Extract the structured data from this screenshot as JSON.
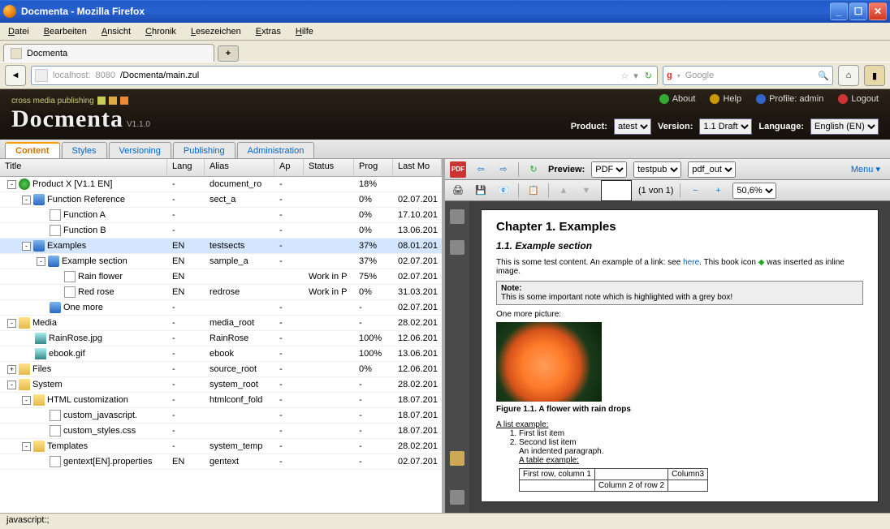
{
  "window": {
    "title": "Docmenta - Mozilla Firefox"
  },
  "ffmenu": [
    "Datei",
    "Bearbeiten",
    "Ansicht",
    "Chronik",
    "Lesezeichen",
    "Extras",
    "Hilfe"
  ],
  "tab": {
    "label": "Docmenta"
  },
  "url": {
    "host": "localhost:",
    "port": "8080",
    "path": "/Docmenta/main.zul"
  },
  "searchplaceholder": "Google",
  "brand": {
    "tagline": "cross media publishing",
    "name": "Docmenta",
    "version": "V1.1.0"
  },
  "headlinks": {
    "about": "About",
    "help": "Help",
    "profile": "Profile: admin",
    "logout": "Logout"
  },
  "selectors": {
    "product_label": "Product:",
    "product": "atest",
    "version_label": "Version:",
    "version": "1.1 Draft",
    "language_label": "Language:",
    "language": "English (EN)"
  },
  "tabs": [
    "Content",
    "Styles",
    "Versioning",
    "Publishing",
    "Administration"
  ],
  "active_tab": "Content",
  "columns": {
    "title": "Title",
    "lang": "Lang",
    "alias": "Alias",
    "ap": "Ap",
    "status": "Status",
    "prog": "Prog",
    "lm": "Last Mo"
  },
  "rows": [
    {
      "indent": 0,
      "toggle": "-",
      "icon": "product",
      "title": "Product X [V1.1 EN]",
      "lang": "-",
      "alias": "document_ro",
      "ap": "-",
      "status": "",
      "prog": "18%",
      "lm": ""
    },
    {
      "indent": 1,
      "toggle": "-",
      "icon": "book",
      "title": "Function Reference",
      "lang": "-",
      "alias": "sect_a",
      "ap": "-",
      "status": "",
      "prog": "0%",
      "lm": "02.07.201"
    },
    {
      "indent": 2,
      "toggle": "",
      "icon": "doc",
      "title": "Function A",
      "lang": "-",
      "alias": "",
      "ap": "-",
      "status": "",
      "prog": "0%",
      "lm": "17.10.201"
    },
    {
      "indent": 2,
      "toggle": "",
      "icon": "doc",
      "title": "Function B",
      "lang": "-",
      "alias": "",
      "ap": "-",
      "status": "",
      "prog": "0%",
      "lm": "13.06.201"
    },
    {
      "indent": 1,
      "toggle": "-",
      "icon": "book",
      "title": "Examples",
      "lang": "EN",
      "alias": "testsects",
      "ap": "-",
      "status": "",
      "prog": "37%",
      "lm": "08.01.201",
      "sel": true
    },
    {
      "indent": 2,
      "toggle": "-",
      "icon": "book",
      "title": "Example section",
      "lang": "EN",
      "alias": "sample_a",
      "ap": "-",
      "status": "",
      "prog": "37%",
      "lm": "02.07.201"
    },
    {
      "indent": 3,
      "toggle": "",
      "icon": "doc",
      "title": "Rain flower",
      "lang": "EN",
      "alias": "",
      "ap": "",
      "status": "Work in P",
      "prog": "75%",
      "lm": "02.07.201"
    },
    {
      "indent": 3,
      "toggle": "",
      "icon": "doc",
      "title": "Red rose",
      "lang": "EN",
      "alias": "redrose",
      "ap": "",
      "status": "Work in P",
      "prog": "0%",
      "lm": "31.03.201"
    },
    {
      "indent": 2,
      "toggle": "",
      "icon": "book",
      "title": "One more",
      "lang": "-",
      "alias": "",
      "ap": "-",
      "status": "",
      "prog": "-",
      "lm": "02.07.201"
    },
    {
      "indent": 0,
      "toggle": "-",
      "icon": "folder",
      "title": "Media",
      "lang": "-",
      "alias": "media_root",
      "ap": "-",
      "status": "",
      "prog": "-",
      "lm": "28.02.201"
    },
    {
      "indent": 1,
      "toggle": "",
      "icon": "img",
      "title": "RainRose.jpg",
      "lang": "-",
      "alias": "RainRose",
      "ap": "-",
      "status": "",
      "prog": "100%",
      "lm": "12.06.201"
    },
    {
      "indent": 1,
      "toggle": "",
      "icon": "img",
      "title": "ebook.gif",
      "lang": "-",
      "alias": "ebook",
      "ap": "-",
      "status": "",
      "prog": "100%",
      "lm": "13.06.201"
    },
    {
      "indent": 0,
      "toggle": "+",
      "icon": "folder",
      "title": "Files",
      "lang": "-",
      "alias": "source_root",
      "ap": "-",
      "status": "",
      "prog": "0%",
      "lm": "12.06.201"
    },
    {
      "indent": 0,
      "toggle": "-",
      "icon": "folder",
      "title": "System",
      "lang": "-",
      "alias": "system_root",
      "ap": "-",
      "status": "",
      "prog": "-",
      "lm": "28.02.201"
    },
    {
      "indent": 1,
      "toggle": "-",
      "icon": "folder",
      "title": "HTML customization",
      "lang": "-",
      "alias": "htmlconf_fold",
      "ap": "-",
      "status": "",
      "prog": "-",
      "lm": "18.07.201"
    },
    {
      "indent": 2,
      "toggle": "",
      "icon": "doc",
      "title": "custom_javascript.",
      "lang": "-",
      "alias": "",
      "ap": "-",
      "status": "",
      "prog": "-",
      "lm": "18.07.201"
    },
    {
      "indent": 2,
      "toggle": "",
      "icon": "doc",
      "title": "custom_styles.css",
      "lang": "-",
      "alias": "",
      "ap": "-",
      "status": "",
      "prog": "-",
      "lm": "18.07.201"
    },
    {
      "indent": 1,
      "toggle": "-",
      "icon": "folder",
      "title": "Templates",
      "lang": "-",
      "alias": "system_temp",
      "ap": "-",
      "status": "",
      "prog": "-",
      "lm": "28.02.201"
    },
    {
      "indent": 2,
      "toggle": "",
      "icon": "doc",
      "title": "gentext[EN].properties",
      "lang": "EN",
      "alias": "gentext",
      "ap": "-",
      "status": "",
      "prog": "-",
      "lm": "02.07.201"
    }
  ],
  "preview": {
    "label": "Preview:",
    "format": "PDF",
    "pub": "testpub",
    "out": "pdf_out",
    "menu": "Menu",
    "page": "1",
    "pagecount": "(1 von 1)",
    "zoom": "50,6%"
  },
  "doc": {
    "chapter": "Chapter 1. Examples",
    "section": "1.1. Example section",
    "intro_a": "This is some test content. An example of a link: see ",
    "intro_link": "here",
    "intro_b": ". This book icon ",
    "intro_c": " was inserted as inline image.",
    "note_h": "Note:",
    "note": "This is some important note which is highlighted with a grey box!",
    "more": "One more picture:",
    "figcap": "Figure 1.1. A flower with rain drops",
    "listh": "A list example:",
    "li1": "First list item",
    "li2": "Second list item",
    "indented": "An indented paragraph.",
    "tableh": "A table example:",
    "t11": "First row, column 1",
    "t13": "Column3",
    "t22": "Column 2 of row 2"
  },
  "status": "javascript:;"
}
